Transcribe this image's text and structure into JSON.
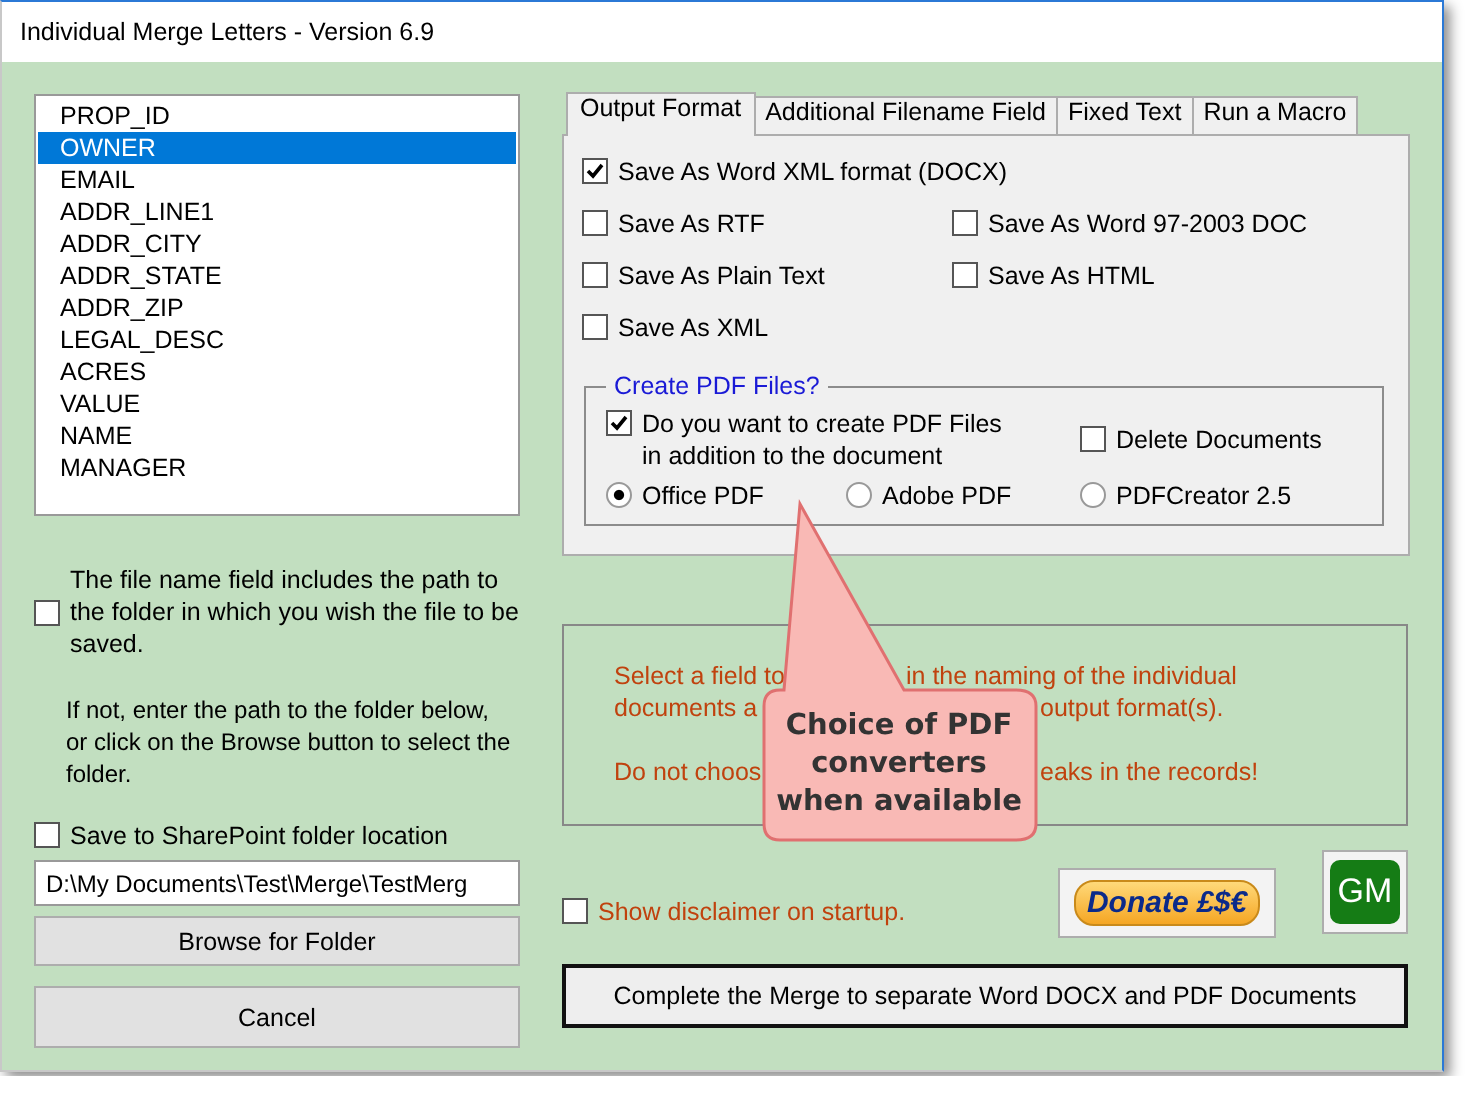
{
  "window": {
    "title": "Individual Merge Letters - Version 6.9"
  },
  "fields": [
    {
      "label": "PROP_ID",
      "selected": false
    },
    {
      "label": "OWNER",
      "selected": true
    },
    {
      "label": "EMAIL",
      "selected": false
    },
    {
      "label": "ADDR_LINE1",
      "selected": false
    },
    {
      "label": "ADDR_CITY",
      "selected": false
    },
    {
      "label": "ADDR_STATE",
      "selected": false
    },
    {
      "label": "ADDR_ZIP",
      "selected": false
    },
    {
      "label": "LEGAL_DESC",
      "selected": false
    },
    {
      "label": "ACRES",
      "selected": false
    },
    {
      "label": "VALUE",
      "selected": false
    },
    {
      "label": "NAME",
      "selected": false
    },
    {
      "label": "MANAGER",
      "selected": false
    }
  ],
  "path_includes": {
    "label": "The file name field includes the path to the folder in which you wish the file to be saved.",
    "checked": false
  },
  "hint": "If not, enter the path to the folder below, or click on the Browse button to select the folder.",
  "sharepoint": {
    "label": "Save to SharePoint folder location",
    "checked": false
  },
  "folder_path": {
    "value": "D:\\My Documents\\Test\\Merge\\TestMerg"
  },
  "browse_button": "Browse for Folder",
  "cancel_button": "Cancel",
  "tabs": [
    {
      "label": "Output Format",
      "selected": true
    },
    {
      "label": "Additional Filename Field",
      "selected": false
    },
    {
      "label": "Fixed Text",
      "selected": false
    },
    {
      "label": "Run a Macro",
      "selected": false
    }
  ],
  "output_options": [
    {
      "label": "Save  As Word XML format (DOCX)",
      "checked": true
    },
    {
      "label": "Save As RTF",
      "checked": false
    },
    {
      "label": "Save As Word 97-2003 DOC",
      "checked": false
    },
    {
      "label": "Save As Plain Text",
      "checked": false
    },
    {
      "label": "Save As HTML",
      "checked": false
    },
    {
      "label": "Save As XML",
      "checked": false
    }
  ],
  "pdf": {
    "title": "Create PDF Files?",
    "create": {
      "label": "Do you want to create PDF Files in addition to the document",
      "checked": true
    },
    "delete_documents": {
      "label": "Delete Documents",
      "checked": false
    },
    "converters": [
      {
        "label": "Office PDF",
        "selected": true
      },
      {
        "label": "Adobe PDF",
        "selected": false
      },
      {
        "label": "PDFCreator 2.5",
        "selected": false
      }
    ]
  },
  "info": [
    {
      "parts": [
        "Select a field to",
        "in the naming of the individual"
      ]
    },
    {
      "parts": [
        "documents a",
        "output format(s)."
      ]
    },
    {
      "parts": [
        "Do not choos",
        "eaks in the records!"
      ]
    }
  ],
  "disclaimer": {
    "label": "Show disclaimer on startup.",
    "checked": false
  },
  "donate_button": "Donate £$€",
  "gm_button": "GM",
  "complete_button": "Complete the Merge to separate Word DOCX and PDF Documents",
  "callout": {
    "text": "Choice of PDF converters when available"
  }
}
